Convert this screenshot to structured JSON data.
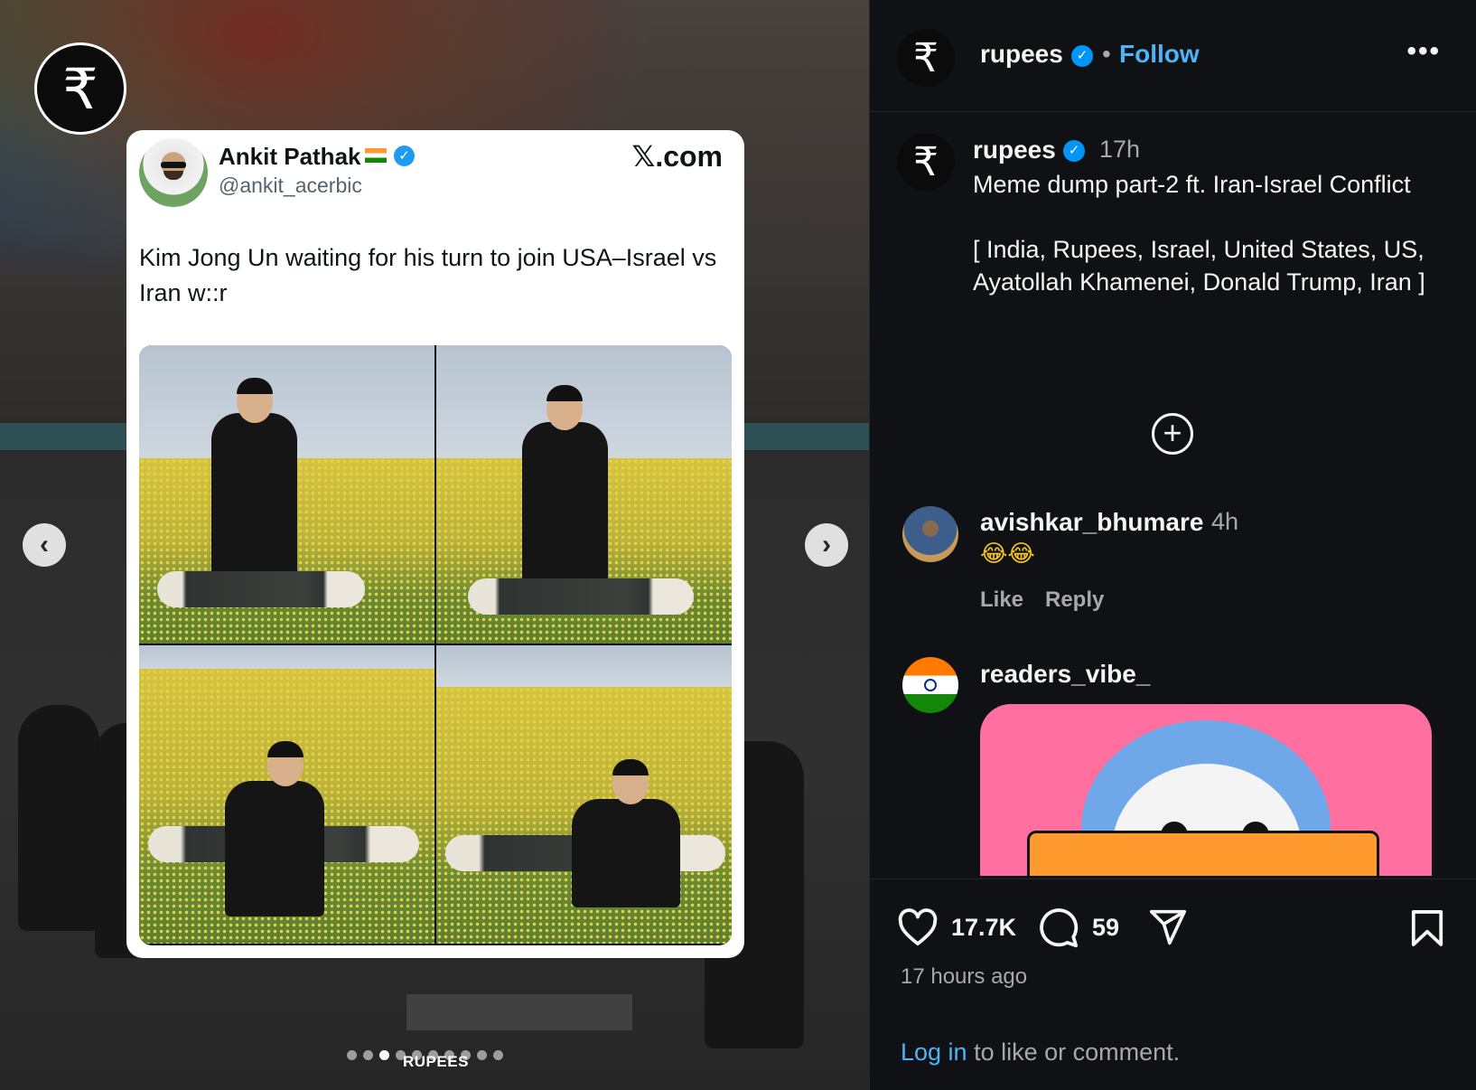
{
  "brand": {
    "logo_glyph": "₹",
    "watermark": "RUPEES"
  },
  "carousel": {
    "total_slides": 10,
    "active_index": 2,
    "prev_glyph": "‹",
    "next_glyph": "›"
  },
  "tweet": {
    "name": "Ankit Pathak",
    "handle": "@ankit_acerbic",
    "source": "𝕏.com",
    "text": "Kim Jong Un waiting for his turn to join USA–Israel vs Iran w::r",
    "verified_glyph": "✓"
  },
  "post": {
    "username": "rupees",
    "follow_label": "Follow",
    "separator": "•",
    "more_glyph": "•••",
    "caption_time": "17h",
    "caption_text": "Meme dump part-2 ft. Iran-Israel Conflict\n\n[ India, Rupees, Israel, United States, US, Ayatollah Khamenei, Donald Trump, Iran ]",
    "add_glyph": "+",
    "verified_glyph": "✓"
  },
  "comments": [
    {
      "username": "avishkar_bhumare",
      "time": "4h",
      "text": "😂😂",
      "like_label": "Like",
      "reply_label": "Reply"
    },
    {
      "username": "readers_vibe_"
    }
  ],
  "actions": {
    "likes": "17.7K",
    "comments": "59",
    "age": "17 hours ago",
    "login_link": "Log in",
    "login_rest": " to like or comment."
  },
  "colors": {
    "accent": "#4cb5f9",
    "verified": "#0095f6",
    "sidebar_bg": "#0f1115",
    "text": "#f5f5f5",
    "muted": "#a8a8a8"
  }
}
